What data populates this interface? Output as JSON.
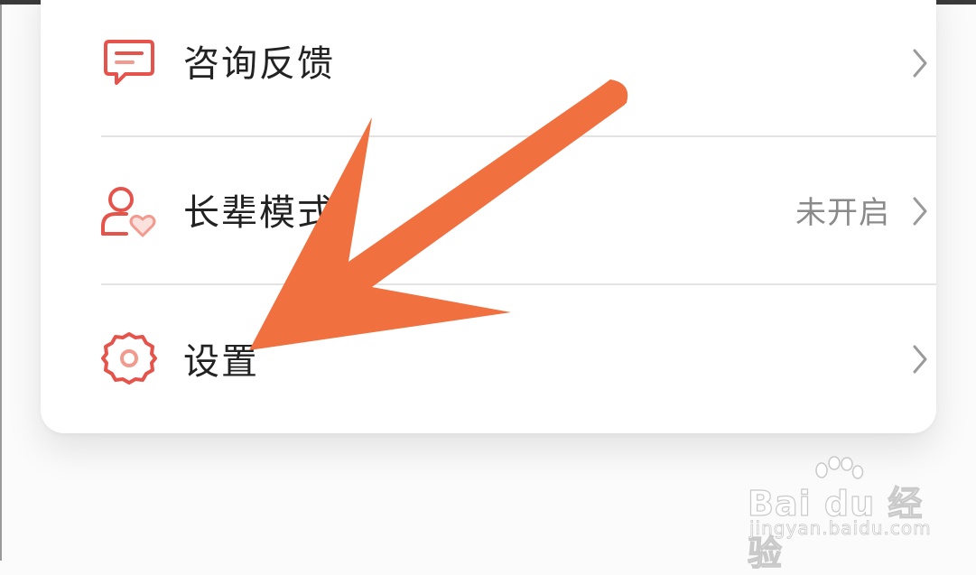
{
  "menu": {
    "items": [
      {
        "label": "咨询反馈",
        "icon": "feedback-chat-icon",
        "value": ""
      },
      {
        "label": "长辈模式",
        "icon": "elder-mode-person-heart-icon",
        "value": "未开启"
      },
      {
        "label": "设置",
        "icon": "settings-gear-icon",
        "value": ""
      }
    ]
  },
  "colors": {
    "accent": "#e5534b",
    "arrow": "#f07040",
    "text": "#222222",
    "secondary_text": "#8a8a8a",
    "divider": "#e3e3e3",
    "chevron": "#9a9a9a"
  },
  "watermark": {
    "logo": "Bai du 经验",
    "url": "jingyan.baidu.com"
  },
  "annotation": {
    "type": "arrow",
    "icon": "orange-arrow-icon"
  }
}
